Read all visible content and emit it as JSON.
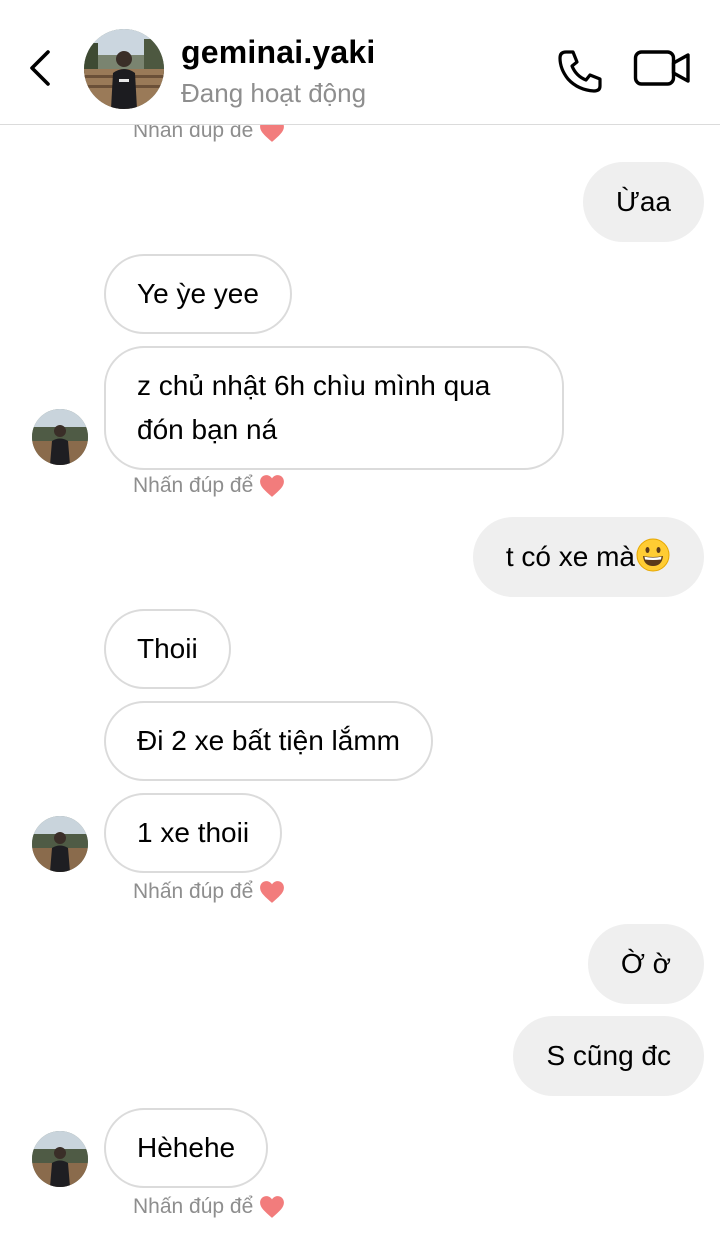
{
  "header": {
    "username": "geminai.yaki",
    "status": "Đang hoạt động"
  },
  "hint_text": "Nhấn đúp để",
  "messages": [
    {
      "side": "out",
      "text": "Ừaa"
    },
    {
      "side": "in",
      "text": "Ye ỳe yee"
    },
    {
      "side": "in",
      "text": "z chủ nhật 6h chìu mình qua đón bạn ná"
    },
    {
      "side": "out",
      "text": "t có xe mà"
    },
    {
      "side": "in",
      "text": "Thoii"
    },
    {
      "side": "in",
      "text": "Đi 2 xe bất tiện lắmm"
    },
    {
      "side": "in",
      "text": "1 xe thoii"
    },
    {
      "side": "out",
      "text": "Ờ ờ"
    },
    {
      "side": "out",
      "text": "S cũng đc"
    },
    {
      "side": "in",
      "text": "Hèhehe"
    }
  ],
  "colors": {
    "incoming_bg": "#ffffff",
    "incoming_border": "#dbdbdb",
    "outgoing_bg": "#efefef",
    "muted_text": "#8e8e8e",
    "heart": "#ed4956"
  },
  "icons": {
    "back": "chevron-left-icon",
    "call": "phone-icon",
    "video": "video-camera-icon",
    "emoji": "grinning-face-emoji",
    "like": "heart-icon"
  }
}
